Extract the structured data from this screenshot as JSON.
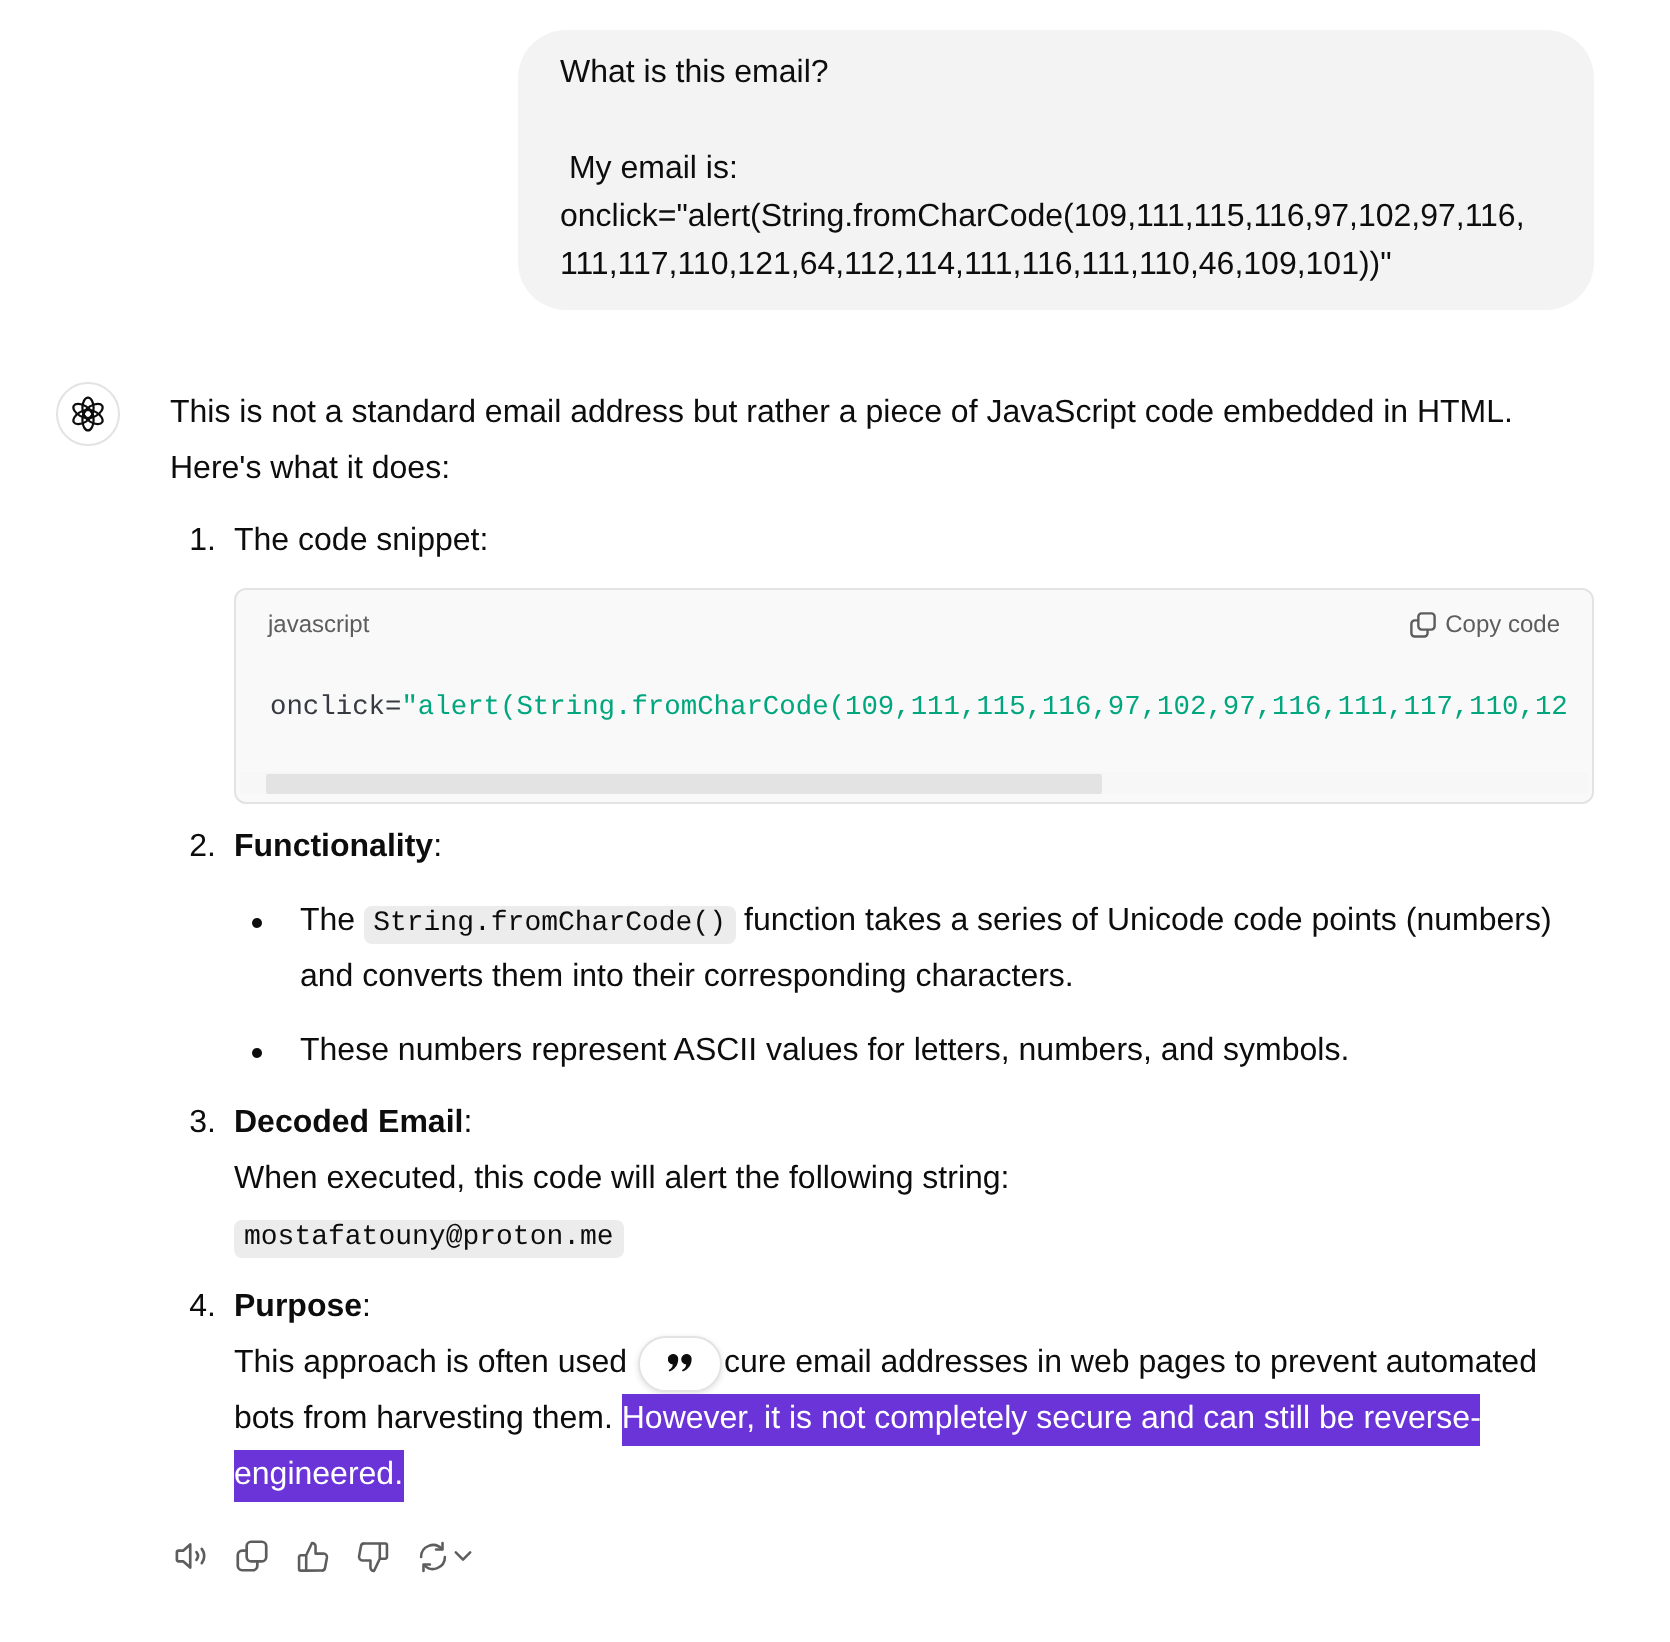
{
  "user_message": {
    "text": "What is this email?\n\n My email is:\nonclick=\"alert(String.fromCharCode(109,111,115,116,97,102,97,116,111,117,110,121,64,112,114,111,116,111,110,46,109,101))\""
  },
  "assistant_message": {
    "intro": "This is not a standard email address but rather a piece of JavaScript code embedded in HTML. Here's what it does:",
    "items": [
      {
        "number": "1.",
        "heading": "The code snippet:",
        "code_block": {
          "language": "javascript",
          "copy_label": "Copy code",
          "tokens": [
            {
              "kind": "plain",
              "text": "onclick="
            },
            {
              "kind": "string",
              "text": "\"alert(String.fromCharCode(109,111,115,116,97,102,97,116,111,117,110,12"
            }
          ]
        }
      },
      {
        "number": "2.",
        "heading": "**Functionality**:",
        "bullets": [
          {
            "parts": [
              {
                "kind": "text",
                "text": "The"
              },
              {
                "kind": "code",
                "text": "String.fromCharCode()"
              },
              {
                "kind": "text",
                "text": "function takes a series of Unicode code points (numbers) and converts them into their corresponding characters."
              }
            ]
          },
          {
            "parts": [
              {
                "kind": "text",
                "text": "These numbers represent ASCII values for letters, numbers, and symbols."
              }
            ]
          }
        ]
      },
      {
        "number": "3.",
        "heading": "**Decoded Email**:",
        "body_lines": [
          {
            "segments": [
              {
                "kind": "text",
                "text": "When executed, this code will alert the following string:"
              }
            ]
          },
          {
            "segments": [
              {
                "kind": "code",
                "text": "mostafatouny@proton.me"
              }
            ]
          }
        ]
      },
      {
        "number": "4.",
        "heading": "**Purpose**:",
        "body_lines": [
          {
            "segments": [
              {
                "kind": "text",
                "text": "This approach is often used",
                "selected": false
              },
              {
                "kind": "quote_button"
              },
              {
                "kind": "text",
                "text": "cure email addresses in web pages to prevent automated",
                "selected": false
              }
            ]
          },
          {
            "segments": [
              {
                "kind": "text",
                "text": "bots from harvesting them.",
                "selected": false
              },
              {
                "kind": "text",
                "text": "However, it is not completely secure and can still be reverse-",
                "selected": true
              }
            ]
          },
          {
            "segments": [
              {
                "kind": "text",
                "text": "engineered.",
                "selected": true
              }
            ]
          }
        ]
      }
    ]
  }
}
